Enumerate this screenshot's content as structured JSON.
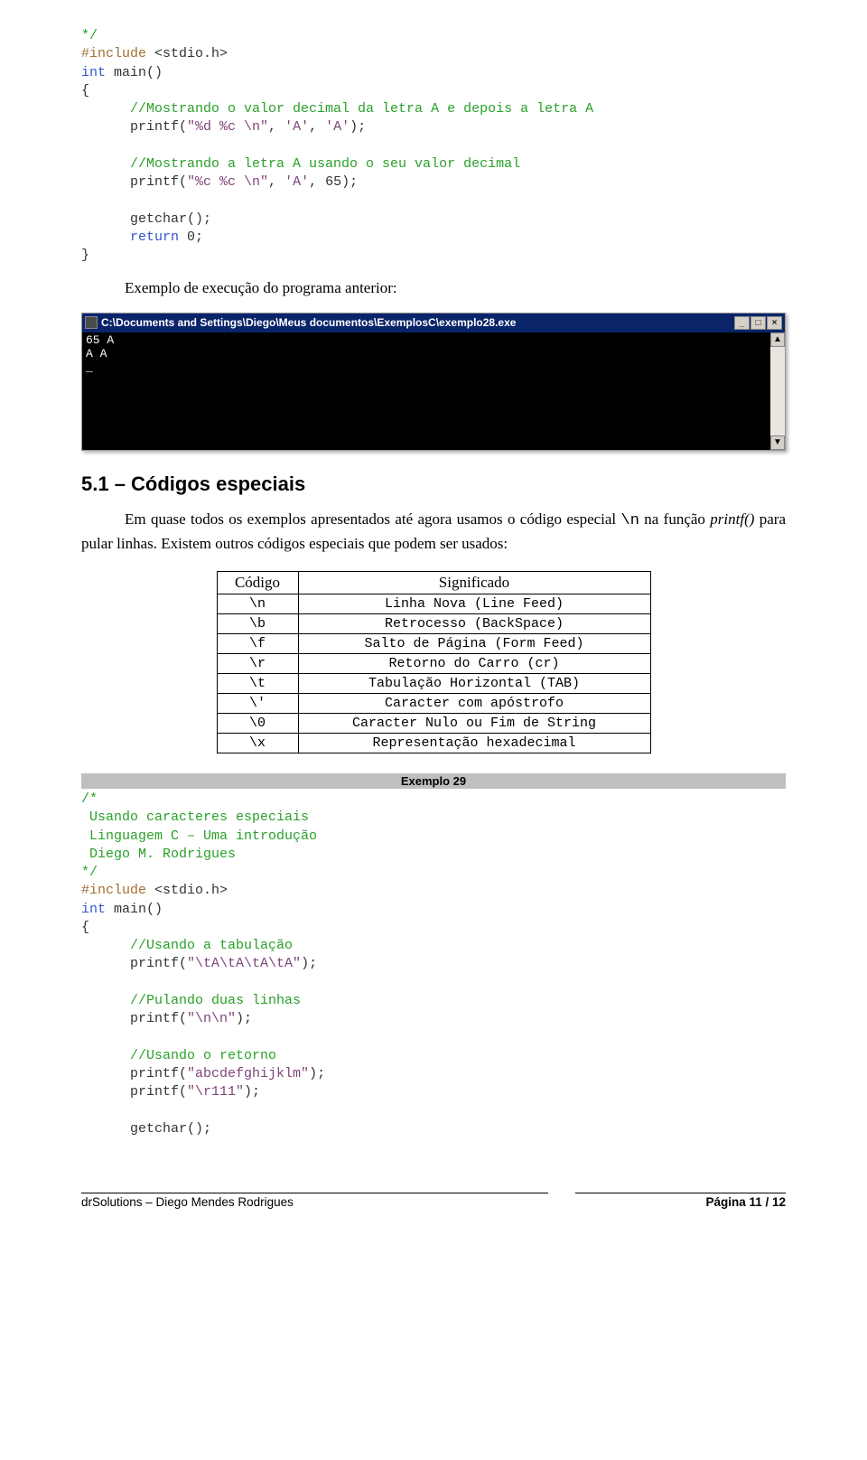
{
  "code_top": {
    "l1": "*/",
    "l2a": "#include",
    "l2b": " <stdio.h>",
    "l3a": "int",
    "l3b": " main()",
    "l4": "{",
    "c1": "      //Mostrando o valor decimal da letra A e depois a letra A",
    "p1a": "      printf(",
    "p1str": "\"%d %c \\n\"",
    "p1b": ", ",
    "p1c": "'A'",
    "p1d": ", ",
    "p1e": "'A'",
    "p1f": ");",
    "c2": "      //Mostrando a letra A usando o seu valor decimal",
    "p2a": "      printf(",
    "p2str": "\"%c %c \\n\"",
    "p2b": ", ",
    "p2c": "'A'",
    "p2d": ", 65);",
    "g1": "      getchar();",
    "r1a": "      return",
    "r1b": " 0;",
    "l5": "}"
  },
  "exec_line": "Exemplo de execução do programa anterior:",
  "terminal": {
    "title_path": "C:\\Documents and Settings\\Diego\\Meus documentos\\ExemplosC\\exemplo28.exe",
    "line1": "65 A",
    "line2": "A A",
    "line3": "_",
    "btn_min": "_",
    "btn_max": "□",
    "btn_close": "×",
    "arrow_up": "▲",
    "arrow_down": "▼"
  },
  "heading": "5.1 – Códigos especiais",
  "para1_a": "Em quase todos os exemplos apresentados até agora usamos o código especial ",
  "para1_code1": "\\n",
  "para1_b": " na função ",
  "para1_i": "printf()",
  "para1_c": " para pular linhas. Existem outros códigos especiais que podem ser usados:",
  "table": {
    "h1": "Código",
    "h2": "Significado",
    "rows": [
      {
        "c": "\\n",
        "s": "Linha Nova (Line Feed)"
      },
      {
        "c": "\\b",
        "s": "Retrocesso (BackSpace)"
      },
      {
        "c": "\\f",
        "s": "Salto de Página (Form Feed)"
      },
      {
        "c": "\\r",
        "s": "Retorno do Carro (cr)"
      },
      {
        "c": "\\t",
        "s": "Tabulação Horizontal (TAB)"
      },
      {
        "c": "\\'",
        "s": "Caracter com apóstrofo"
      },
      {
        "c": "\\0",
        "s": "Caracter Nulo ou Fim de String"
      },
      {
        "c": "\\x",
        "s": "Representação hexadecimal"
      }
    ]
  },
  "exemplo_label": "Exemplo 29",
  "code_bottom": {
    "c0": "/*",
    "c1": " Usando caracteres especiais",
    "c2": " Linguagem C – Uma introdução",
    "c3": " Diego M. Rodrigues",
    "c4": "*/",
    "l1a": "#include",
    "l1b": " <stdio.h>",
    "l2a": "int",
    "l2b": " main()",
    "l3": "{",
    "cc1": "      //Usando a tabulação",
    "p1a": "      printf(",
    "p1str": "\"\\tA\\tA\\tA\\tA\"",
    "p1b": ");",
    "cc2": "      //Pulando duas linhas",
    "p2a": "      printf(",
    "p2str": "\"\\n\\n\"",
    "p2b": ");",
    "cc3": "      //Usando o retorno",
    "p3a": "      printf(",
    "p3str": "\"abcdefghijklm\"",
    "p3b": ");",
    "p4a": "      printf(",
    "p4str": "\"\\r111\"",
    "p4b": ");",
    "g1": "      getchar();"
  },
  "footer": {
    "left": "drSolutions – Diego Mendes Rodrigues",
    "right": "Página 11 / 12"
  }
}
